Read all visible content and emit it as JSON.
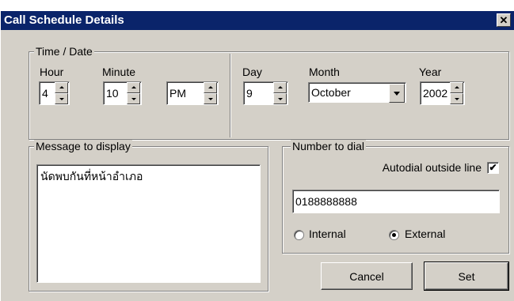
{
  "window": {
    "title": "Call Schedule Details",
    "close_glyph": "✕"
  },
  "time_date": {
    "legend": "Time / Date",
    "hour_label": "Hour",
    "hour_value": "4",
    "minute_label": "Minute",
    "minute_value": "10",
    "ampm_value": "PM",
    "day_label": "Day",
    "day_value": "9",
    "month_label": "Month",
    "month_value": "October",
    "year_label": "Year",
    "year_value": "2002"
  },
  "message": {
    "legend": "Message to display",
    "text": "นัดพบกันที่หน้าอำเภอ"
  },
  "dial": {
    "legend": "Number to dial",
    "autodial_label": "Autodial outside line",
    "autodial_checked": "✔",
    "number_value": "0188888888",
    "internal_label": "Internal",
    "external_label": "External",
    "selected": "External"
  },
  "buttons": {
    "cancel_label": "Cancel",
    "set_label": "Set"
  }
}
